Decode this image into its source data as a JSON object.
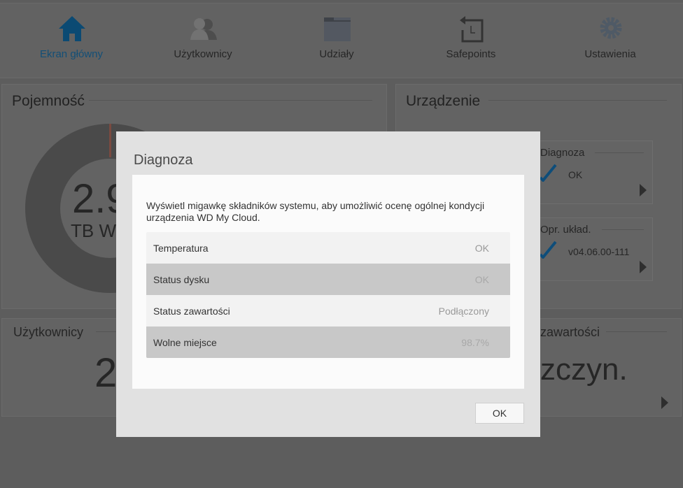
{
  "nav": {
    "items": [
      {
        "label": "Ekran główny",
        "icon": "home-icon",
        "active": true
      },
      {
        "label": "Użytkownicy",
        "icon": "users-icon"
      },
      {
        "label": "Udziały",
        "icon": "folder-icon"
      },
      {
        "label": "Safepoints",
        "icon": "safepoint-icon"
      },
      {
        "label": "Ustawienia",
        "icon": "gear-icon"
      }
    ]
  },
  "capacity": {
    "title": "Pojemność",
    "value_partial": "2.9",
    "unit_partial": "TB W"
  },
  "device": {
    "title": "Urządzenie",
    "diagnosis": {
      "title": "Diagnoza",
      "status": "OK"
    },
    "firmware": {
      "title": "Opr. układ.",
      "version": "v04.06.00-111"
    }
  },
  "users": {
    "title": "Użytkownicy",
    "count_partial": "2"
  },
  "content": {
    "title_partial": "zawartości",
    "value_partial": "zczyn."
  },
  "modal": {
    "title": "Diagnoza",
    "description": "Wyświetl migawkę składników systemu, aby umożliwić ocenę ogólnej kondycji urządzenia WD My Cloud.",
    "rows": [
      {
        "label": "Temperatura",
        "value": "OK"
      },
      {
        "label": "Status dysku",
        "value": "OK"
      },
      {
        "label": "Status zawartości",
        "value": "Podłączony"
      },
      {
        "label": "Wolne miejsce",
        "value": "98.7%"
      }
    ],
    "ok_label": "OK"
  },
  "colors": {
    "accent": "#134f77",
    "check": "#0e4d7a"
  }
}
